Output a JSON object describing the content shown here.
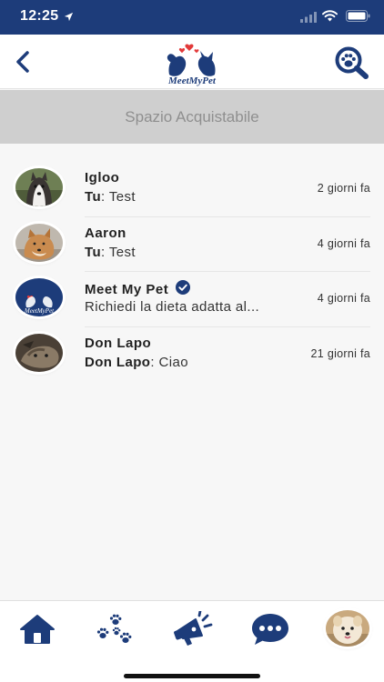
{
  "status_bar": {
    "time": "12:25",
    "icons": [
      "location-arrow-icon",
      "signal-icon",
      "wifi-icon",
      "battery-icon"
    ]
  },
  "nav": {
    "back_icon": "chevron-left-icon",
    "logo_text": "MeetMyPet",
    "search_icon": "paw-search-icon"
  },
  "ad_banner": {
    "text": "Spazio Acquistabile"
  },
  "chats": [
    {
      "name": "Igloo",
      "sender": "Tu",
      "message": "Test",
      "time": "2 giorni fa"
    },
    {
      "name": "Aaron",
      "sender": "Tu",
      "message": "Test",
      "time": "4 giorni fa"
    },
    {
      "name": "Meet My Pet",
      "verified": true,
      "message": "Richiedi la dieta adatta al...",
      "time": "4 giorni fa"
    },
    {
      "name": "Don Lapo",
      "sender": "Don Lapo",
      "message": "Ciao",
      "time": "21 giorni fa"
    }
  ],
  "tab_bar": {
    "items": [
      "home-icon",
      "paws-icon",
      "megaphone-icon",
      "chat-bubble-icon",
      "profile-avatar"
    ]
  },
  "colors": {
    "brand": "#1d3c7a",
    "banner_bg": "#cfcfcf",
    "banner_text": "#8f8f8f",
    "page_bg": "#f7f7f7"
  }
}
